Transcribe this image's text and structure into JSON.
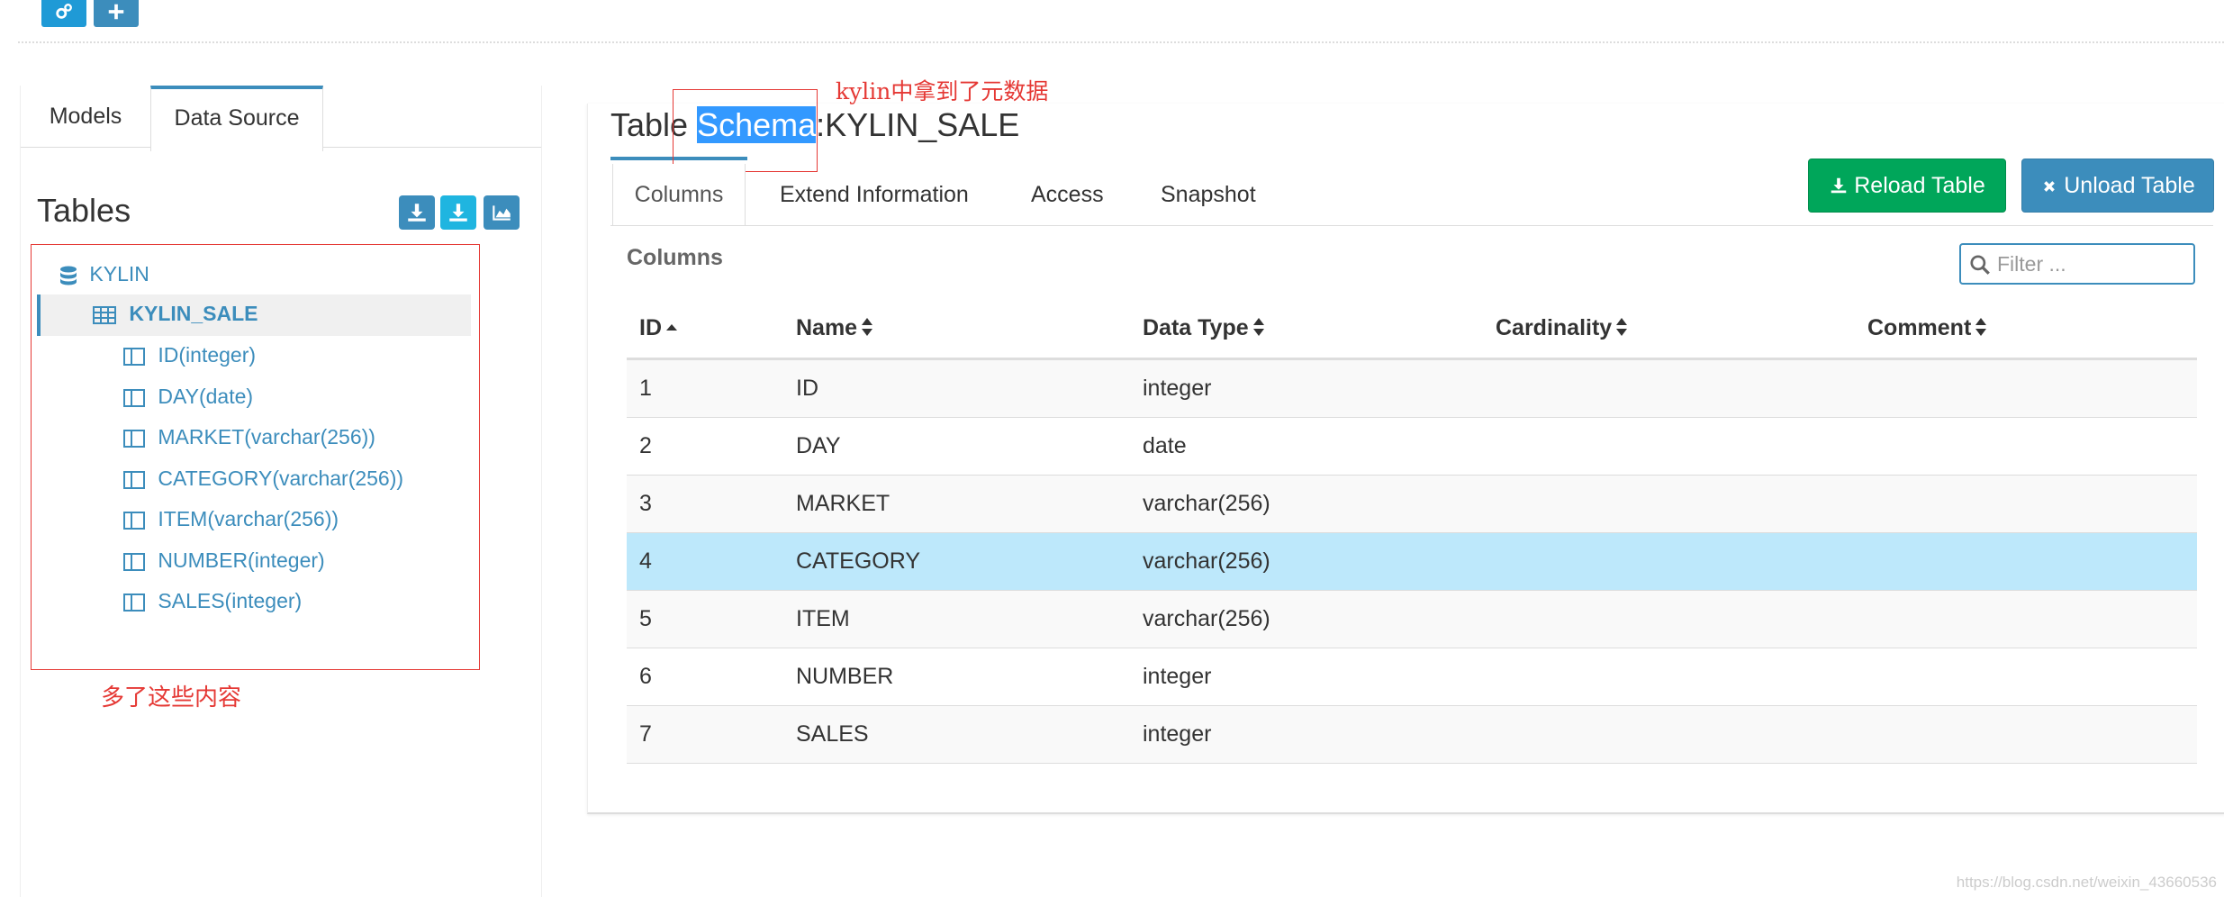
{
  "toolbar": {
    "icons": [
      "gears-icon",
      "plus-icon"
    ]
  },
  "left": {
    "tabs": [
      {
        "label": "Models"
      },
      {
        "label": "Data Source"
      }
    ],
    "tables_title": "Tables",
    "tree": {
      "database": "KYLIN",
      "table": "KYLIN_SALE",
      "columns": [
        "ID(integer)",
        "DAY(date)",
        "MARKET(varchar(256))",
        "CATEGORY(varchar(256))",
        "ITEM(varchar(256))",
        "NUMBER(integer)",
        "SALES(integer)"
      ]
    },
    "annotation": "多了这些内容"
  },
  "right": {
    "title_prefix": "Table ",
    "title_highlight": "Schema",
    "title_suffix": ":KYLIN_SALE",
    "annotation": "kylin中拿到了元数据",
    "tabs": [
      {
        "label": "Columns"
      },
      {
        "label": "Extend Information"
      },
      {
        "label": "Access"
      },
      {
        "label": "Snapshot"
      }
    ],
    "reload_label": "Reload Table",
    "unload_label": "Unload Table",
    "columns_title": "Columns",
    "filter_placeholder": "Filter ...",
    "headers": [
      "ID",
      "Name",
      "Data Type",
      "Cardinality",
      "Comment"
    ],
    "rows": [
      {
        "id": "1",
        "name": "ID",
        "type": "integer"
      },
      {
        "id": "2",
        "name": "DAY",
        "type": "date"
      },
      {
        "id": "3",
        "name": "MARKET",
        "type": "varchar(256)"
      },
      {
        "id": "4",
        "name": "CATEGORY",
        "type": "varchar(256)"
      },
      {
        "id": "5",
        "name": "ITEM",
        "type": "varchar(256)"
      },
      {
        "id": "6",
        "name": "NUMBER",
        "type": "integer"
      },
      {
        "id": "7",
        "name": "SALES",
        "type": "integer"
      }
    ]
  },
  "watermark": "https://blog.csdn.net/weixin_43660536",
  "colors": {
    "primary": "#3c8dbc",
    "success": "#00a65a",
    "annotation": "#e53935",
    "highlight_row": "#bde8fb"
  }
}
